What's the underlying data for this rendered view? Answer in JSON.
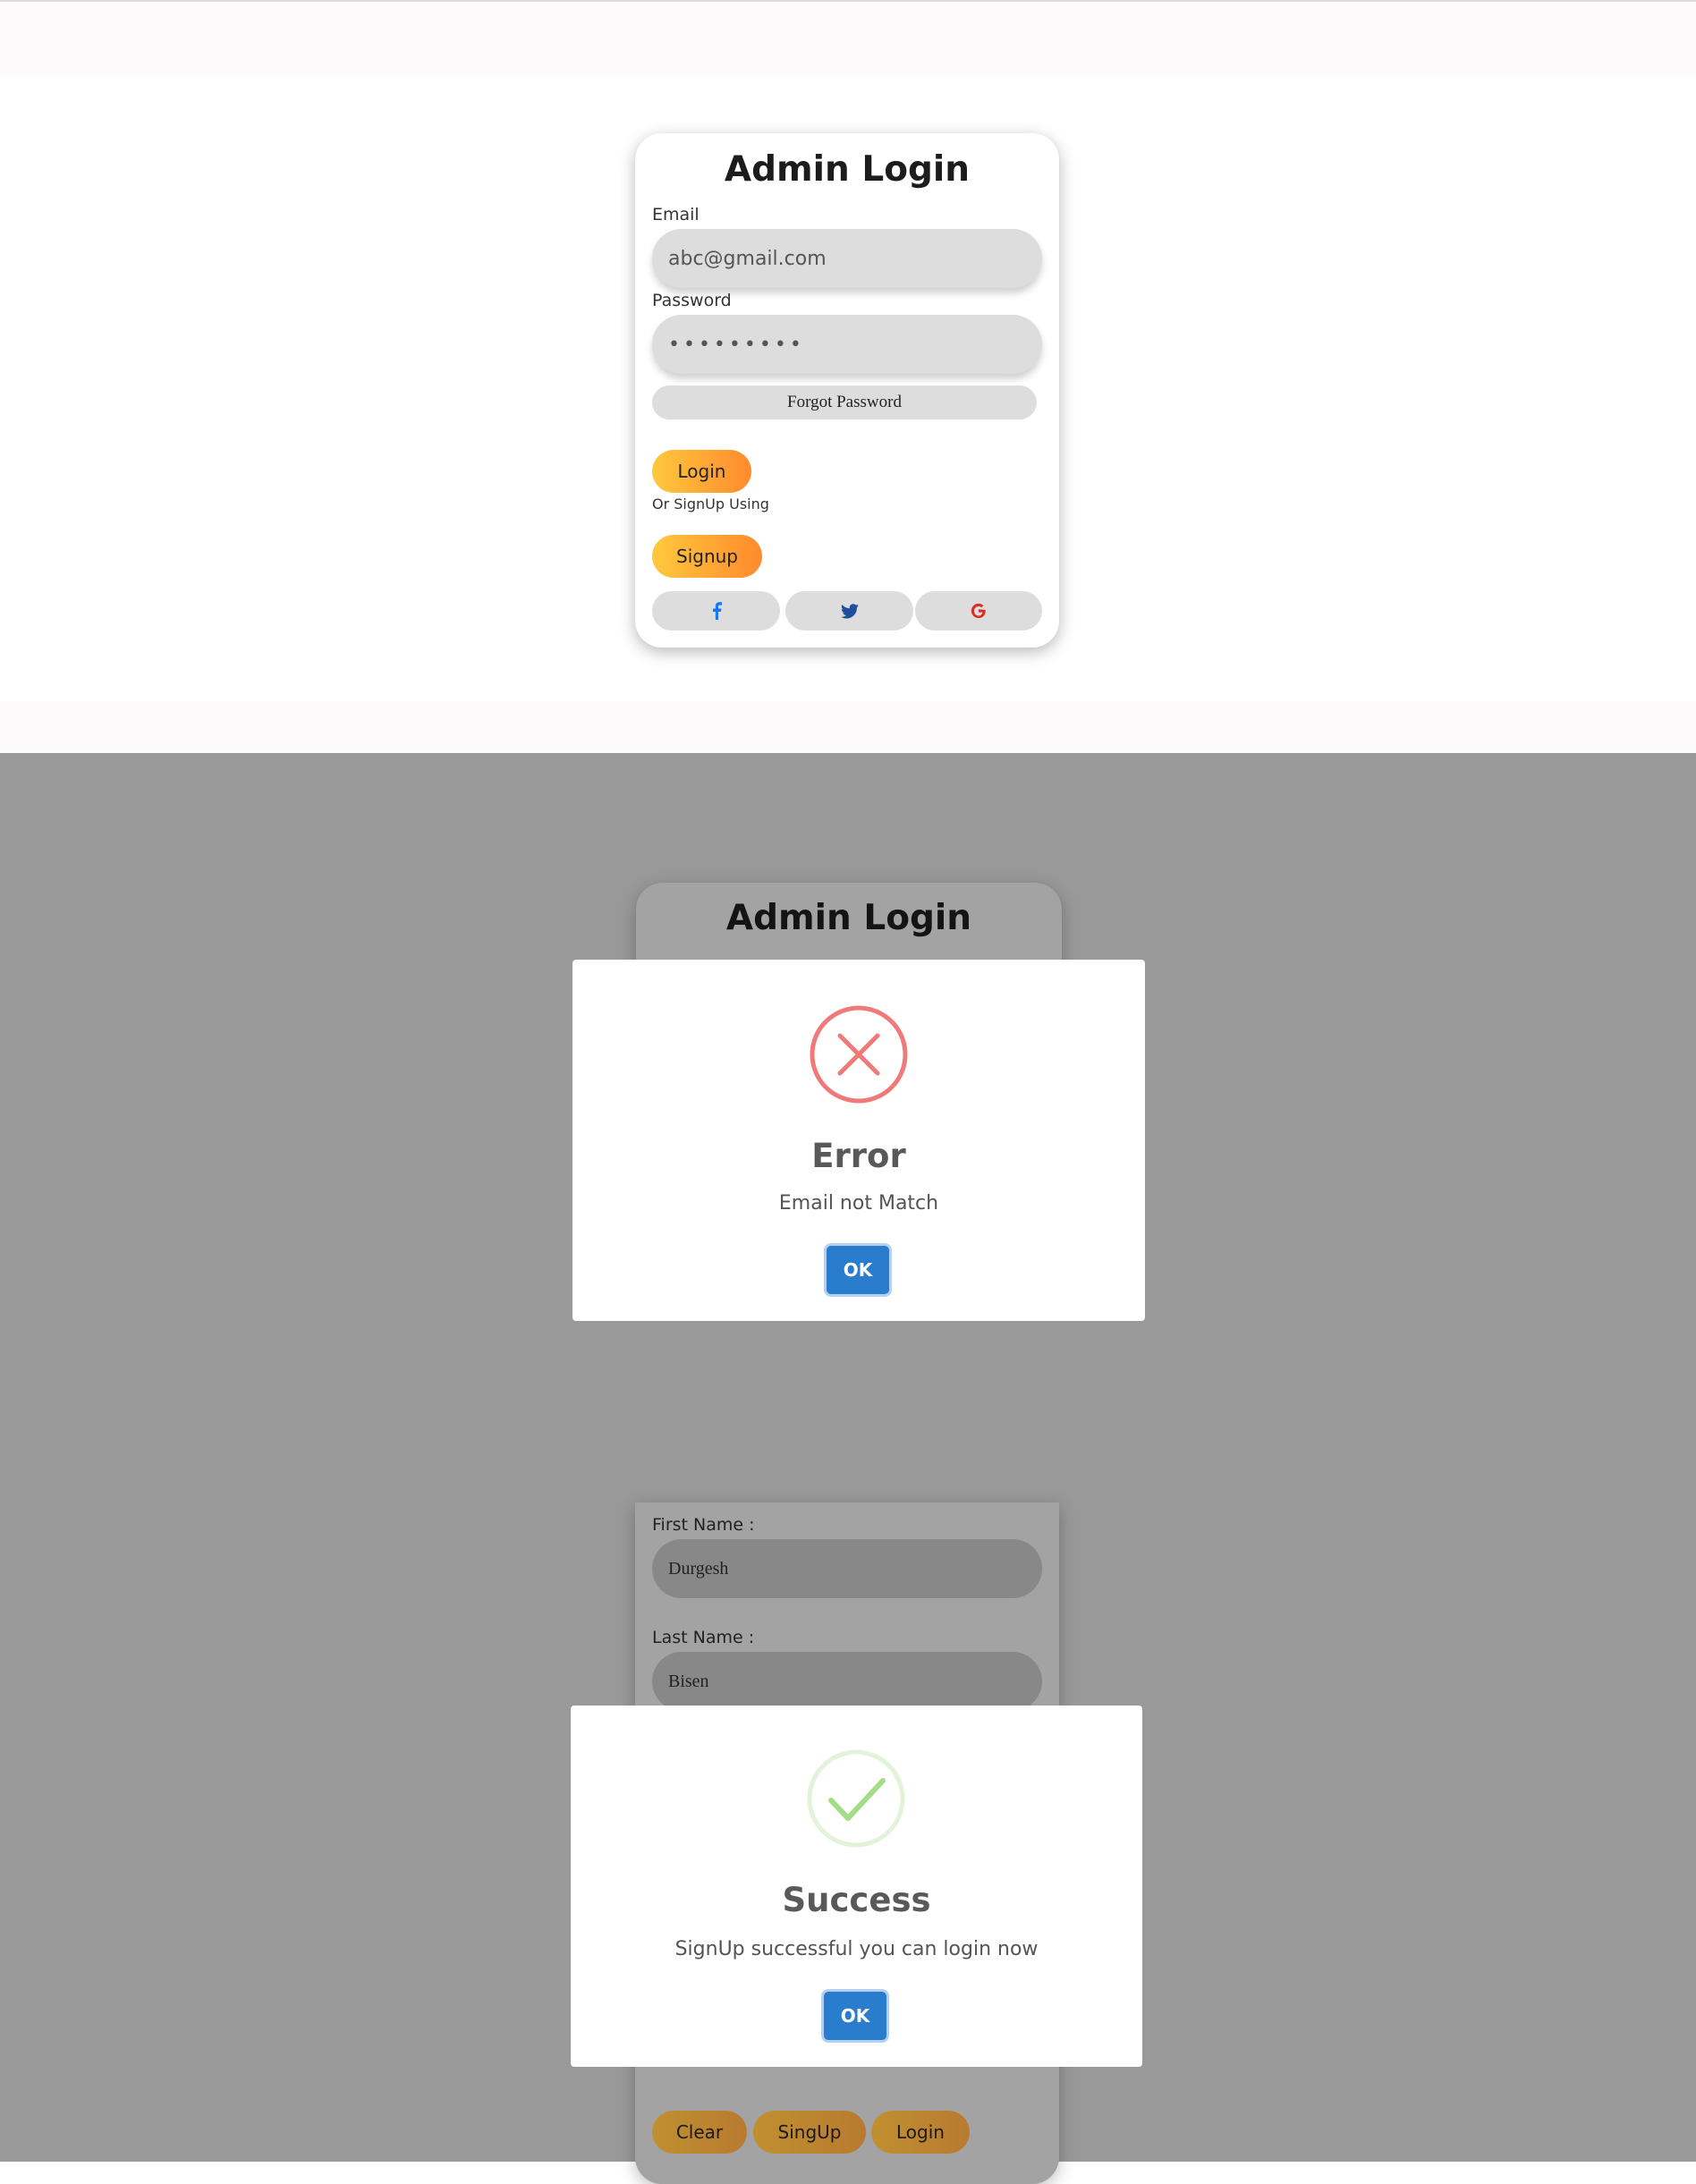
{
  "login_card": {
    "title": "Admin Login",
    "email_label": "Email",
    "email_value": "abc@gmail.com",
    "password_label": "Password",
    "password_value": "•••••••••",
    "forgot_label": "Forgot Password",
    "login_label": "Login",
    "or_text": "Or SignUp Using",
    "signup_label": "Signup",
    "social_icons": [
      "facebook-icon",
      "twitter-icon",
      "google-icon"
    ]
  },
  "error_dialog": {
    "icon": "error-x-icon",
    "title": "Error",
    "message": "Email not Match",
    "ok_label": "OK"
  },
  "signup_form": {
    "first_name_label": "First Name :",
    "first_name_value": "Durgesh",
    "last_name_label": "Last Name :",
    "last_name_value": "Bisen",
    "clear_label": "Clear",
    "signup_label": "SingUp",
    "login_label": "Login"
  },
  "success_dialog": {
    "icon": "success-check-icon",
    "title": "Success",
    "message": "SignUp successful you can login now",
    "ok_label": "OK"
  },
  "colors": {
    "accent_gradient": [
      "#ffc93d",
      "#ff8a2d"
    ],
    "ok_button": "#2a7ccc",
    "error_red": "#f07a7a",
    "success_green": "#a5dc86",
    "overlay": "#999999"
  }
}
